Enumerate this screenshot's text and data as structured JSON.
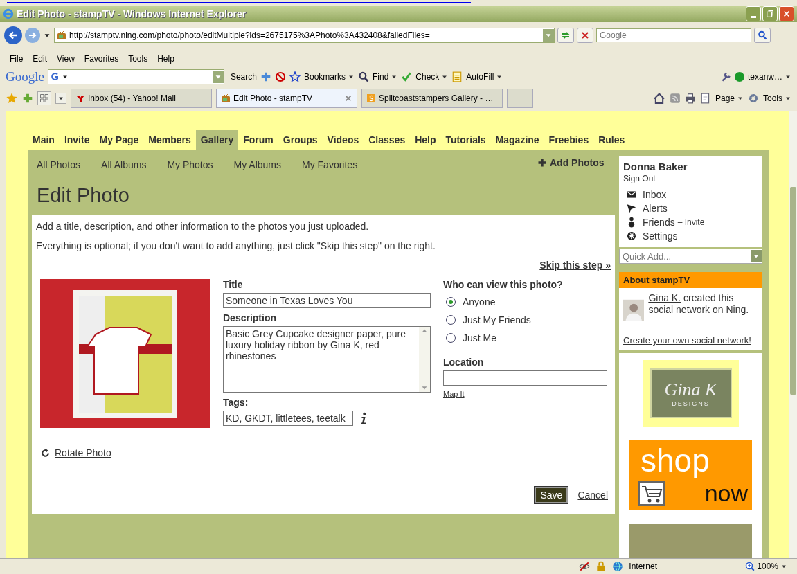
{
  "window": {
    "title": "Edit Photo - stampTV - Windows Internet Explorer"
  },
  "address": {
    "url": "http://stamptv.ning.com/photo/photo/editMultiple?ids=2675175%3APhoto%3A432408&failedFiles=",
    "search_placeholder": "Google"
  },
  "menu": [
    "File",
    "Edit",
    "View",
    "Favorites",
    "Tools",
    "Help"
  ],
  "google_toolbar": {
    "logo": "Google",
    "search": "Search",
    "bookmarks": "Bookmarks",
    "find": "Find",
    "check": "Check",
    "autofill": "AutoFill",
    "account": "texanw…"
  },
  "browser_tabs": [
    {
      "label": "Inbox (54) - Yahoo! Mail",
      "selected": false,
      "kind": "yahoo"
    },
    {
      "label": "Edit Photo - stampTV",
      "selected": true,
      "kind": "site"
    },
    {
      "label": "Splitcoaststampers Gallery - …",
      "selected": false,
      "kind": "splitcoast"
    }
  ],
  "command_bar": {
    "page": "Page",
    "tools": "Tools"
  },
  "site_nav": [
    {
      "label": "Main",
      "selected": false
    },
    {
      "label": "Invite",
      "selected": false
    },
    {
      "label": "My Page",
      "selected": false
    },
    {
      "label": "Members",
      "selected": false
    },
    {
      "label": "Gallery",
      "selected": true
    },
    {
      "label": "Forum",
      "selected": false
    },
    {
      "label": "Groups",
      "selected": false
    },
    {
      "label": "Videos",
      "selected": false
    },
    {
      "label": "Classes",
      "selected": false
    },
    {
      "label": "Help",
      "selected": false
    },
    {
      "label": "Tutorials",
      "selected": false
    },
    {
      "label": "Magazine",
      "selected": false
    },
    {
      "label": "Freebies",
      "selected": false
    },
    {
      "label": "Rules",
      "selected": false
    }
  ],
  "sub_nav": [
    "All Photos",
    "All Albums",
    "My Photos",
    "My Albums",
    "My Favorites"
  ],
  "add_photos": "Add Photos",
  "heading": "Edit Photo",
  "intro": [
    "Add a title, description, and other information to the photos you just uploaded.",
    "Everything is optional; if you don't want to add anything, just click \"Skip this step\" on the right."
  ],
  "skip": "Skip this step »",
  "form": {
    "title_label": "Title",
    "title_value": "Someone in Texas Loves You",
    "description_label": "Description",
    "description_value": "Basic Grey Cupcake designer paper, pure luxury holiday ribbon by Gina K, red rhinestones",
    "tags_label": "Tags:",
    "tags_value": "KD, GKDT, littletees, teetalk",
    "privacy_label": "Who can view this photo?",
    "privacy_options": [
      {
        "label": "Anyone",
        "selected": true
      },
      {
        "label": "Just My Friends",
        "selected": false
      },
      {
        "label": "Just Me",
        "selected": false
      }
    ],
    "location_label": "Location",
    "map_link": "Map It",
    "rotate": "Rotate Photo",
    "save": "Save",
    "cancel": "Cancel"
  },
  "sidebar": {
    "user": "Donna Baker",
    "sign_out": "Sign Out",
    "links": [
      {
        "label": "Inbox",
        "kind": "inbox"
      },
      {
        "label": "Alerts",
        "kind": "alerts"
      },
      {
        "label": "Friends",
        "kind": "friends",
        "extra": "– Invite"
      },
      {
        "label": "Settings",
        "kind": "settings"
      }
    ],
    "quick_add": "Quick Add...",
    "about_title": "About stampTV",
    "about_text": {
      "creator_link": "Gina K.",
      "middle": " created this social network on ",
      "platform_link": "Ning",
      "end": "."
    },
    "create_link": "Create your own social network!",
    "logo_script": "Gina K",
    "logo_sub": "DESIGNS",
    "shop_top": "shop",
    "shop_bottom": "now"
  },
  "status_bar": {
    "zone": "Internet",
    "zoom": "100%"
  }
}
